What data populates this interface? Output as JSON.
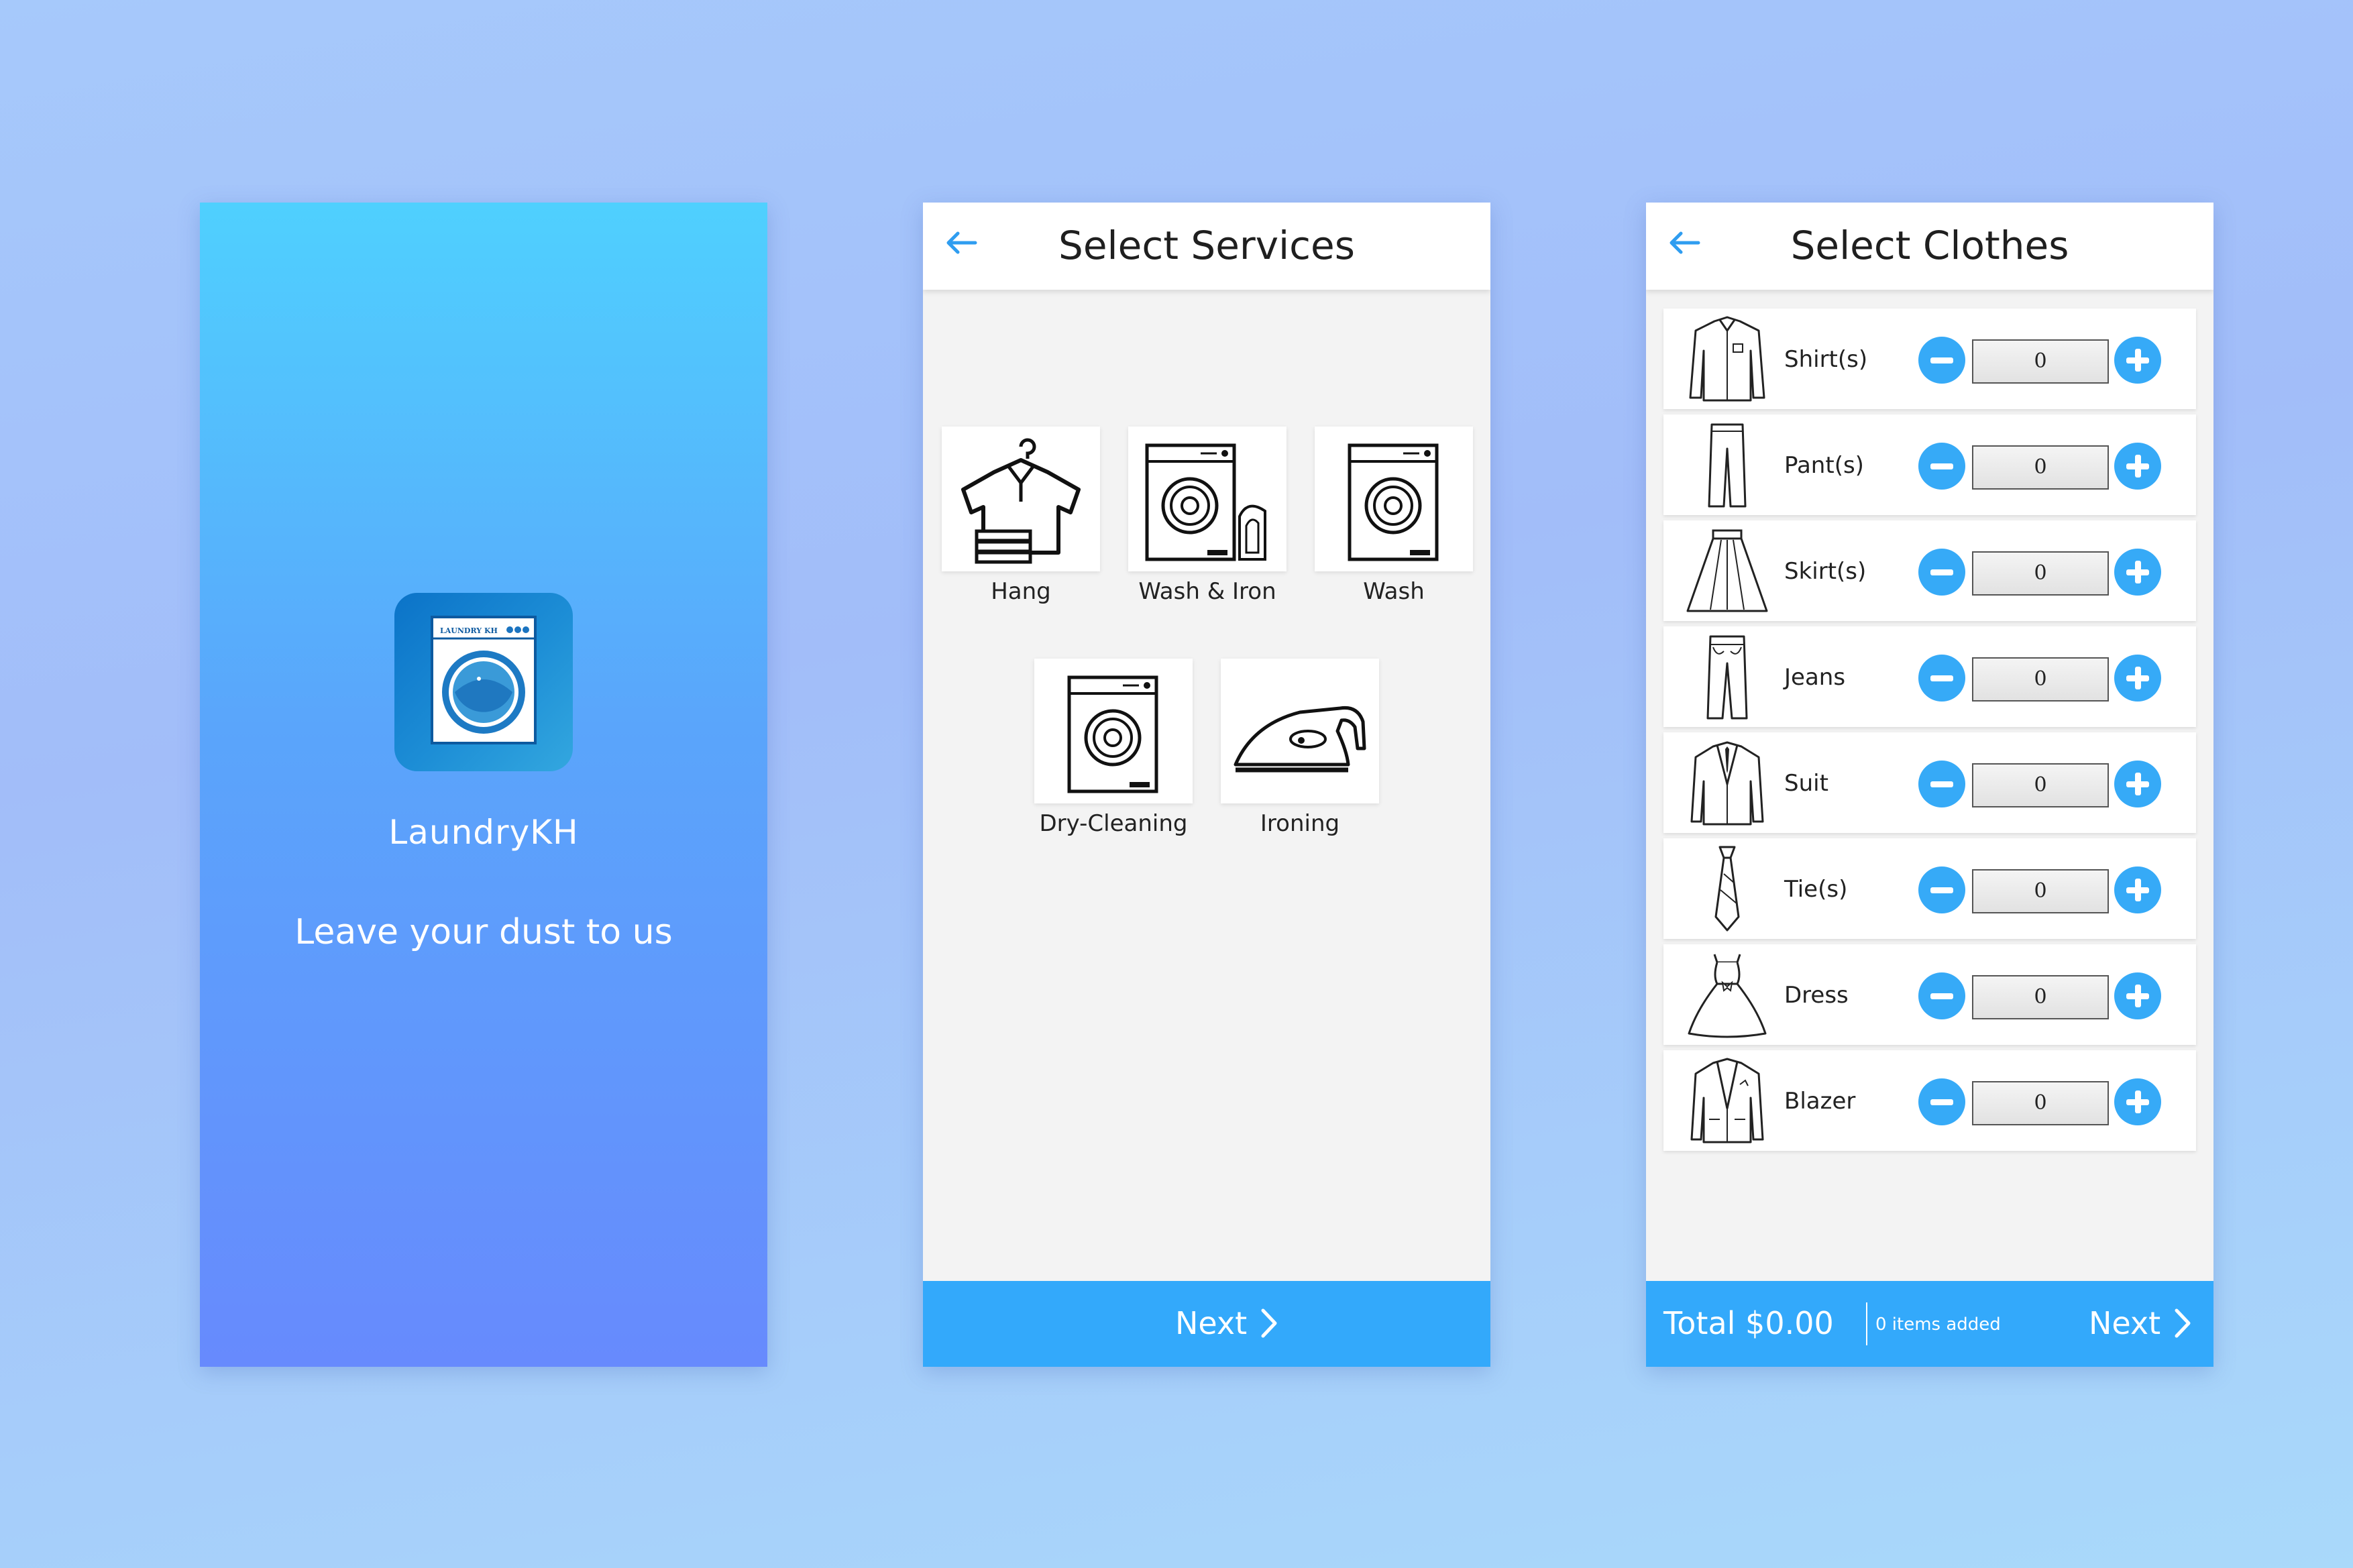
{
  "colors": {
    "accent": "#33a9fb",
    "splash_top": "#4fd0fe",
    "splash_bottom": "#678afd",
    "panel_bg": "#f3f3f3"
  },
  "splash": {
    "logo_text": "LAUNDRY KH",
    "app_name": "LaundryKH",
    "tagline": "Leave your dust to us"
  },
  "services": {
    "title": "Select Services",
    "items": [
      {
        "label": "Hang",
        "icon": "hanger-shirt-icon"
      },
      {
        "label": "Wash & Iron",
        "icon": "washing-machine-iron-icon"
      },
      {
        "label": "Wash",
        "icon": "washing-machine-icon"
      },
      {
        "label": "Dry-Cleaning",
        "icon": "dry-cleaning-machine-icon"
      },
      {
        "label": "Ironing",
        "icon": "iron-icon"
      }
    ],
    "next_label": "Next"
  },
  "clothes": {
    "title": "Select Clothes",
    "items": [
      {
        "label": "Shirt(s)",
        "qty": "0",
        "icon": "shirt-icon"
      },
      {
        "label": "Pant(s)",
        "qty": "0",
        "icon": "pants-icon"
      },
      {
        "label": "Skirt(s)",
        "qty": "0",
        "icon": "skirt-icon"
      },
      {
        "label": "Jeans",
        "qty": "0",
        "icon": "jeans-icon"
      },
      {
        "label": "Suit",
        "qty": "0",
        "icon": "suit-icon"
      },
      {
        "label": "Tie(s)",
        "qty": "0",
        "icon": "tie-icon"
      },
      {
        "label": "Dress",
        "qty": "0",
        "icon": "dress-icon"
      },
      {
        "label": "Blazer",
        "qty": "0",
        "icon": "blazer-icon"
      }
    ],
    "total": "Total $0.00",
    "items_added": "0 items added",
    "next_label": "Next"
  }
}
